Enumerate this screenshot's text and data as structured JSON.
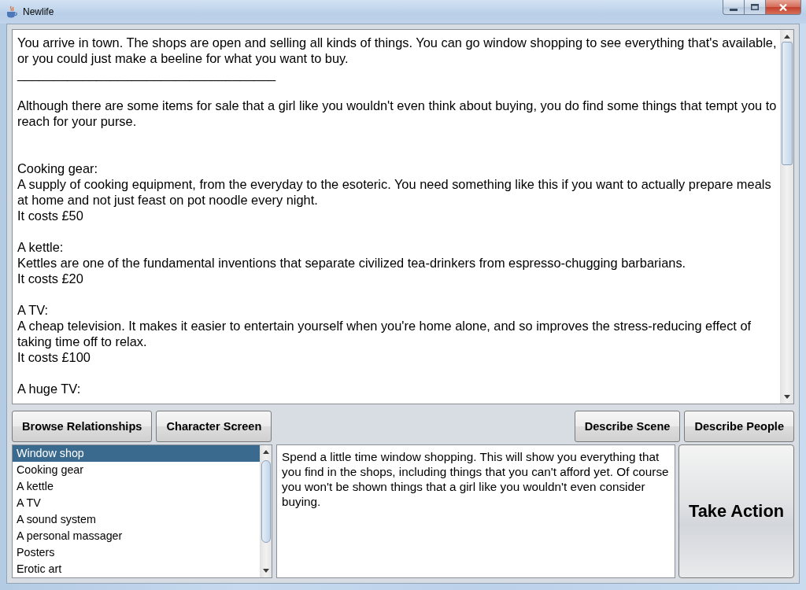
{
  "window": {
    "title": "Newlife"
  },
  "story": {
    "intro": "You arrive in town. The shops are open and selling all kinds of things. You can go window shopping to see everything that's available, or you could just make a beeline for what you want to buy.",
    "rule": "____________________________________",
    "note": "Although there are some items for sale that a girl like you wouldn't even think about buying, you do find some things that tempt you to reach for your purse.",
    "items": [
      {
        "name": "Cooking gear:",
        "description": "A supply of cooking equipment, from the everyday to the esoteric. You need something like this if you want to actually prepare meals at home and not just feast on pot noodle every night.",
        "price": "It costs £50"
      },
      {
        "name": "A kettle:",
        "description": "Kettles are one of the fundamental inventions that separate civilized tea-drinkers from espresso-chugging barbarians.",
        "price": "It costs £20"
      },
      {
        "name": "A TV:",
        "description": "A cheap television. It makes it easier to entertain yourself when you're home alone, and so improves the stress-reducing effect of taking time off to relax.",
        "price": "It costs £100"
      },
      {
        "name": "A huge TV:"
      }
    ]
  },
  "toolbar": {
    "left": [
      "Browse Relationships",
      "Character Screen"
    ],
    "right": [
      "Describe Scene",
      "Describe People"
    ]
  },
  "actions": [
    {
      "label": "Window shop",
      "selected": true
    },
    {
      "label": "Cooking gear",
      "selected": false
    },
    {
      "label": "A kettle",
      "selected": false
    },
    {
      "label": "A TV",
      "selected": false
    },
    {
      "label": "A sound system",
      "selected": false
    },
    {
      "label": "A personal massager",
      "selected": false
    },
    {
      "label": "Posters",
      "selected": false
    },
    {
      "label": "Erotic art",
      "selected": false
    }
  ],
  "action_description": "Spend a little time window shopping. This will show you everything that you find in the shops, including things that you can't afford yet. Of course you won't be shown things that a girl like you wouldn't even consider buying.",
  "take_action_button": "Take Action"
}
